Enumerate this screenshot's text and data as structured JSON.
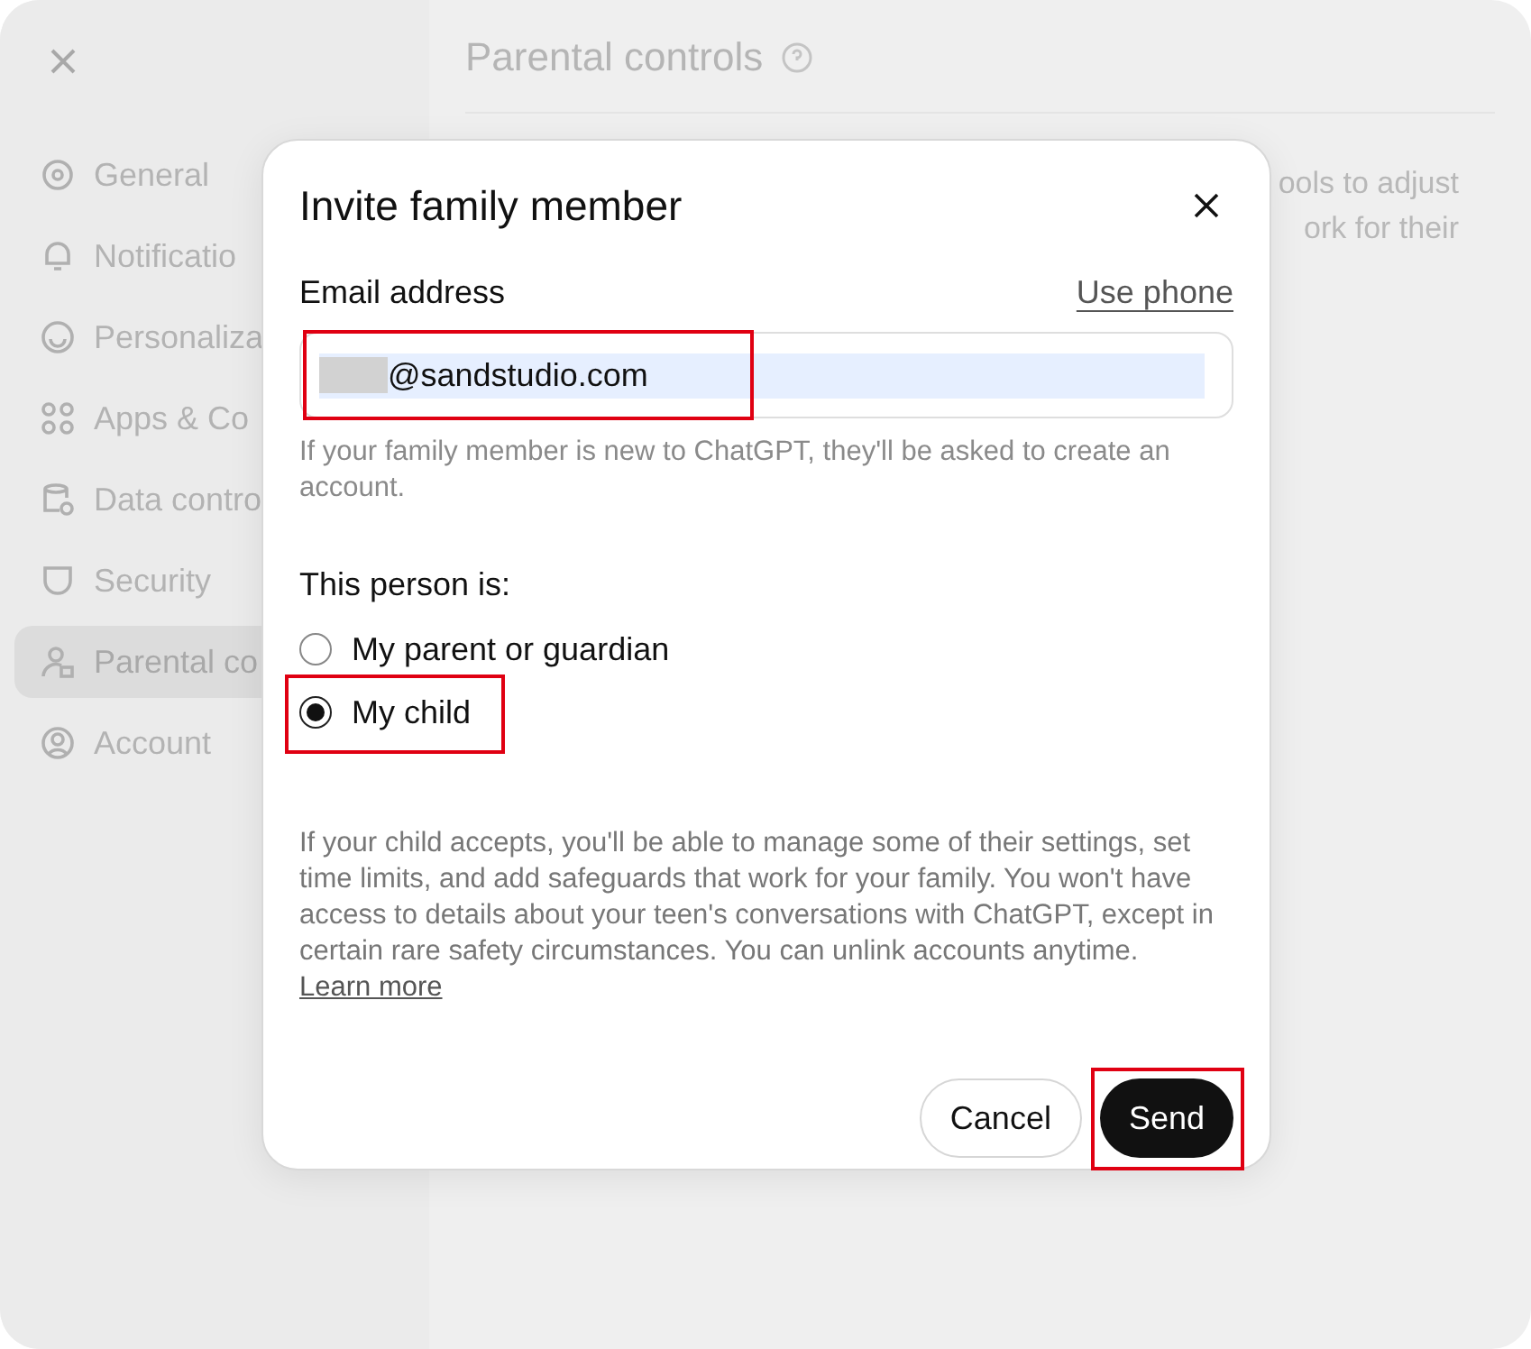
{
  "sidebar": {
    "items": [
      {
        "label": "General",
        "selected": false
      },
      {
        "label": "Notificatio",
        "selected": false
      },
      {
        "label": "Personaliza",
        "selected": false
      },
      {
        "label": "Apps & Co",
        "selected": false
      },
      {
        "label": "Data contro",
        "selected": false
      },
      {
        "label": "Security",
        "selected": false
      },
      {
        "label": "Parental co",
        "selected": true
      },
      {
        "label": "Account",
        "selected": false
      }
    ]
  },
  "main": {
    "title": "Parental controls",
    "text_lines": [
      "ools to adjust",
      "ork for their"
    ]
  },
  "dialog": {
    "title": "Invite family member",
    "email_label": "Email address",
    "use_phone": "Use phone",
    "email_value": "@sandstudio.com",
    "email_hint": "If your family member is new to ChatGPT, they'll be asked to create an account.",
    "person_label": "This person is:",
    "radios": [
      {
        "label": "My parent or guardian",
        "selected": false
      },
      {
        "label": "My child",
        "selected": true
      }
    ],
    "info": "If your child accepts, you'll be able to manage some of their settings, set time limits, and add safeguards that work for your family. You won't have access to details about your teen's conversations with ChatGPT, except in certain rare safety circumstances. You can unlink accounts anytime.",
    "learn_more": "Learn more",
    "buttons": [
      {
        "label": "Cancel",
        "kind": "secondary"
      },
      {
        "label": "Send",
        "kind": "primary"
      }
    ]
  }
}
